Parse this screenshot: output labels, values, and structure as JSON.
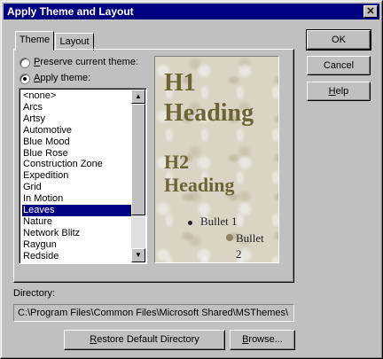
{
  "window": {
    "title": "Apply Theme and Layout",
    "close_glyph": "✕"
  },
  "tabs": [
    {
      "label": "Theme",
      "active": true
    },
    {
      "label": "Layout",
      "active": false
    }
  ],
  "options": {
    "preserve_label": "Preserve current theme:",
    "apply_label": "Apply theme:",
    "selected": "apply"
  },
  "theme_list": {
    "items": [
      "<none>",
      "Arcs",
      "Artsy",
      "Automotive",
      "Blue Mood",
      "Blue Rose",
      "Construction Zone",
      "Expedition",
      "Grid",
      "In Motion",
      "Leaves",
      "Nature",
      "Network Blitz",
      "Raygun",
      "Redside"
    ],
    "selected": "Leaves"
  },
  "preview": {
    "h1_line1": "H1",
    "h1_line2": "Heading",
    "h2_line1": "H2",
    "h2_line2": "Heading",
    "bullet1": "Bullet 1",
    "bullet2_line1": "Bullet",
    "bullet2_line2": "2"
  },
  "buttons": {
    "ok": "OK",
    "cancel": "Cancel",
    "help": "Help",
    "restore": "Restore Default Directory",
    "browse": "Browse..."
  },
  "directory": {
    "label": "Directory:",
    "value": "C:\\Program Files\\Common Files\\Microsoft Shared\\MSThemes\\"
  },
  "colors": {
    "titlebar": "#000080",
    "face": "#c0c0c0",
    "selection": "#000080",
    "heading": "#6b6433"
  }
}
